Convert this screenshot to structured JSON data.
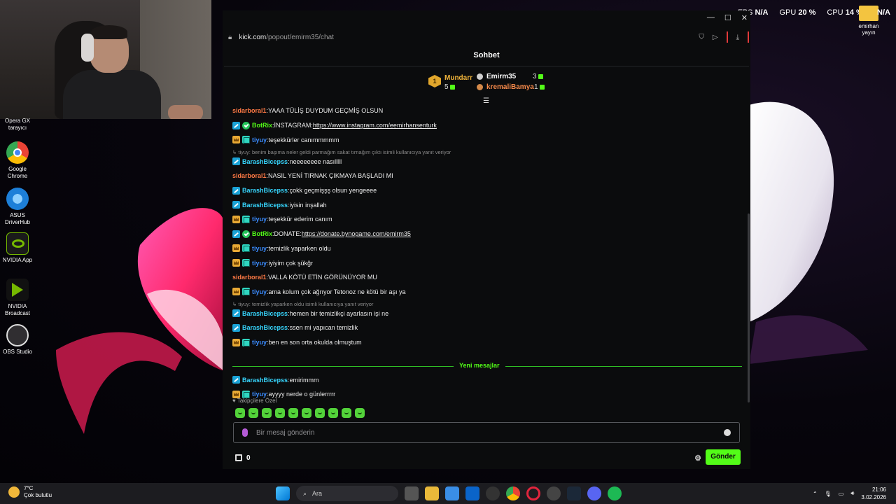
{
  "overlay": {
    "fps_label": "FPS",
    "fps_value": "N/A",
    "gpu_label": "GPU",
    "gpu_value": "20 %",
    "cpu_label": "CPU",
    "cpu_value": "14 %",
    "extra_value": "N/A",
    "folder_label": "emirhan yayın"
  },
  "desktop_icons": [
    {
      "label": "Opera GX tarayıcı",
      "icon": "opera-gx-icon"
    },
    {
      "label": "Google Chrome",
      "icon": "chrome-icon"
    },
    {
      "label": "ASUS DriverHub",
      "icon": "asus-driverhub-icon"
    },
    {
      "label": "NVIDIA App",
      "icon": "nvidia-app-icon"
    },
    {
      "label": "NVIDIA Broadcast",
      "icon": "nvidia-broadcast-icon"
    },
    {
      "label": "OBS Studio",
      "icon": "obs-studio-icon"
    }
  ],
  "browser": {
    "url_host": "kick.com",
    "url_path": "/popout/emirm35/chat"
  },
  "chat": {
    "title": "Sohbet",
    "leaderboard": {
      "rank": "1",
      "first": {
        "name": "Mundarr",
        "count": "5"
      },
      "second": {
        "name": "Emirm35",
        "count": "3"
      },
      "third": {
        "name": "kremaliBamya",
        "count": "1"
      }
    },
    "messages": [
      {
        "user": "sidarboral1",
        "color": "#ff7a45",
        "badges": [],
        "text": "YAAA TÜLİŞ DUYDUM GEÇMİŞ OLSUN"
      },
      {
        "user": "BotRix",
        "color": "#53fc18",
        "badges": [
          "mod",
          "bot"
        ],
        "text": "İNSTAGRAM: ",
        "link": "https://www.instagram.com/eemirhansenturk"
      },
      {
        "user": "tiyuy",
        "color": "#3b8cff",
        "badges": [
          "vip",
          "sub"
        ],
        "text": "teşekkürler canımmmmm"
      },
      {
        "reply": "tiyuy: benim başıma neler geldi parmağım sakat tırnağım çıktı isimli kullanıcıya yanıt veriyor"
      },
      {
        "user": "BarashBicepss",
        "color": "#37d7ff",
        "badges": [
          "mod"
        ],
        "text": "neeeeeeee nasılllll"
      },
      {
        "user": "sidarboral1",
        "color": "#ff7a45",
        "badges": [],
        "text": "NASIL YENİ TIRNAK ÇIKMAYA BAŞLADI MI"
      },
      {
        "user": "BarashBicepss",
        "color": "#37d7ff",
        "badges": [
          "mod"
        ],
        "text": "çokk geçmişşş olsun yengeeee"
      },
      {
        "user": "BarashBicepss",
        "color": "#37d7ff",
        "badges": [
          "mod"
        ],
        "text": "iyisin inşallah"
      },
      {
        "user": "tiyuy",
        "color": "#3b8cff",
        "badges": [
          "vip",
          "sub"
        ],
        "text": "teşekkür ederim canım"
      },
      {
        "user": "BotRix",
        "color": "#53fc18",
        "badges": [
          "mod",
          "bot"
        ],
        "text": "DONATE: ",
        "link": "https://donate.bynogame.com/emirm35"
      },
      {
        "user": "tiyuy",
        "color": "#3b8cff",
        "badges": [
          "vip",
          "sub"
        ],
        "text": "temizlik yaparken oldu"
      },
      {
        "user": "tiyuy",
        "color": "#3b8cff",
        "badges": [
          "vip",
          "sub"
        ],
        "text": "iyiyim çok şükğr"
      },
      {
        "user": "sidarboral1",
        "color": "#ff7a45",
        "badges": [],
        "text": "VALLA KÖTÜ ETİN GÖRÜNÜYOR MU"
      },
      {
        "user": "tiyuy",
        "color": "#3b8cff",
        "badges": [
          "vip",
          "sub"
        ],
        "text": "ama kolum çok ağrıyor Tetonoz ne kötü bir aşı ya"
      },
      {
        "reply": "tiyuy: temizlik yaparken oldu isimli kullanıcıya yanıt veriyor"
      },
      {
        "user": "BarashBicepss",
        "color": "#37d7ff",
        "badges": [
          "mod"
        ],
        "text": "hemen bir temizlikçi ayarlasın işi ne"
      },
      {
        "user": "BarashBicepss",
        "color": "#37d7ff",
        "badges": [
          "mod"
        ],
        "text": "ssen mi yapıcan temizlik"
      },
      {
        "user": "tiyuy",
        "color": "#3b8cff",
        "badges": [
          "vip",
          "sub"
        ],
        "text": "ben en son orta okulda olmuştum"
      }
    ],
    "new_messages_label": "Yeni mesajlar",
    "new_messages": [
      {
        "user": "BarashBicepss",
        "color": "#37d7ff",
        "badges": [
          "mod"
        ],
        "text": "emirimmm"
      },
      {
        "user": "tiyuy",
        "color": "#3b8cff",
        "badges": [
          "vip",
          "sub"
        ],
        "text": "ayyyy nerde o günlerrrrr"
      }
    ],
    "emote_label": "Takipçilere Özel",
    "input_placeholder": "Bir mesaj gönderin",
    "store_count": "0",
    "send_label": "Gönder"
  },
  "taskbar": {
    "temperature": "7°C",
    "weather": "Çok bulutlu",
    "search_label": "Ara",
    "time": "21:06",
    "date": "3.02.2026"
  }
}
